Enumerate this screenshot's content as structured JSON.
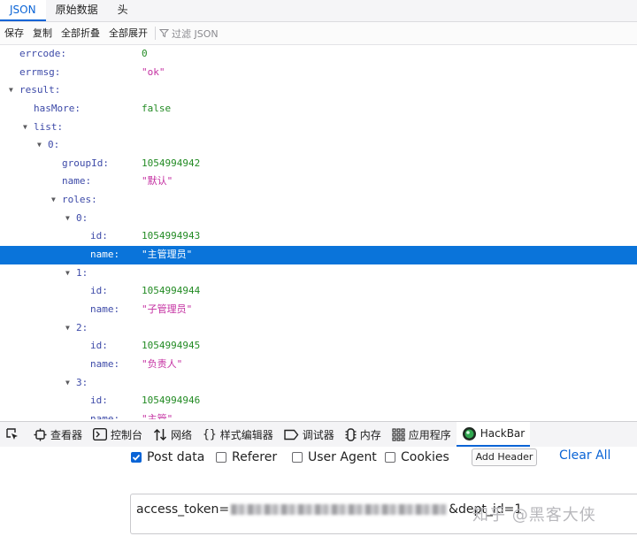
{
  "tabs": [
    {
      "label": "JSON",
      "active": true
    },
    {
      "label": "原始数据",
      "active": false
    },
    {
      "label": "头",
      "active": false
    }
  ],
  "toolbar": {
    "save": "保存",
    "copy": "复制",
    "collapse_all": "全部折叠",
    "expand_all": "全部展开",
    "filter_placeholder": "过滤 JSON"
  },
  "json_rows": [
    {
      "indent": 0,
      "key": "errcode:",
      "value": "0",
      "type": "num"
    },
    {
      "indent": 0,
      "key": "errmsg:",
      "value": "\"ok\"",
      "type": "str"
    },
    {
      "indent": 0,
      "key": "result:",
      "value": "",
      "twisty": true
    },
    {
      "indent": 1,
      "key": "hasMore:",
      "value": "false",
      "type": "bool"
    },
    {
      "indent": 1,
      "key": "list:",
      "value": "",
      "twisty": true
    },
    {
      "indent": 2,
      "key": "0:",
      "value": "",
      "twisty": true
    },
    {
      "indent": 3,
      "key": "groupId:",
      "value": "1054994942",
      "type": "num"
    },
    {
      "indent": 3,
      "key": "name:",
      "value": "\"默认\"",
      "type": "str"
    },
    {
      "indent": 3,
      "key": "roles:",
      "value": "",
      "twisty": true
    },
    {
      "indent": 4,
      "key": "0:",
      "value": "",
      "twisty": true
    },
    {
      "indent": 5,
      "key": "id:",
      "value": "1054994943",
      "type": "num"
    },
    {
      "indent": 5,
      "key": "name:",
      "value": "\"主管理员\"",
      "type": "str",
      "selected": true
    },
    {
      "indent": 4,
      "key": "1:",
      "value": "",
      "twisty": true
    },
    {
      "indent": 5,
      "key": "id:",
      "value": "1054994944",
      "type": "num"
    },
    {
      "indent": 5,
      "key": "name:",
      "value": "\"子管理员\"",
      "type": "str"
    },
    {
      "indent": 4,
      "key": "2:",
      "value": "",
      "twisty": true
    },
    {
      "indent": 5,
      "key": "id:",
      "value": "1054994945",
      "type": "num"
    },
    {
      "indent": 5,
      "key": "name:",
      "value": "\"负责人\"",
      "type": "str"
    },
    {
      "indent": 4,
      "key": "3:",
      "value": "",
      "twisty": true
    },
    {
      "indent": 5,
      "key": "id:",
      "value": "1054994946",
      "type": "num"
    },
    {
      "indent": 5,
      "key": "name:",
      "value": "\"主管\"",
      "type": "str"
    }
  ],
  "devtools": {
    "inspector": "查看器",
    "console": "控制台",
    "network": "网络",
    "style_editor": "样式编辑器",
    "debugger": "调试器",
    "memory": "内存",
    "application": "应用程序",
    "hackbar": "HackBar"
  },
  "hackbar": {
    "post_data": "Post data",
    "post_data_checked": true,
    "referer": "Referer",
    "user_agent": "User Agent",
    "cookies": "Cookies",
    "add_header": "Add Header",
    "clear_all": "Clear All",
    "url_prefix": "access_token=",
    "url_suffix": "&dept_id=1"
  },
  "watermark": "知乎 @黑客大侠",
  "colors": {
    "accent": "#0a64d6",
    "selected_row": "#0a74da",
    "key": "#3d4aa8",
    "number": "#238b24",
    "string": "#c42fa1"
  }
}
